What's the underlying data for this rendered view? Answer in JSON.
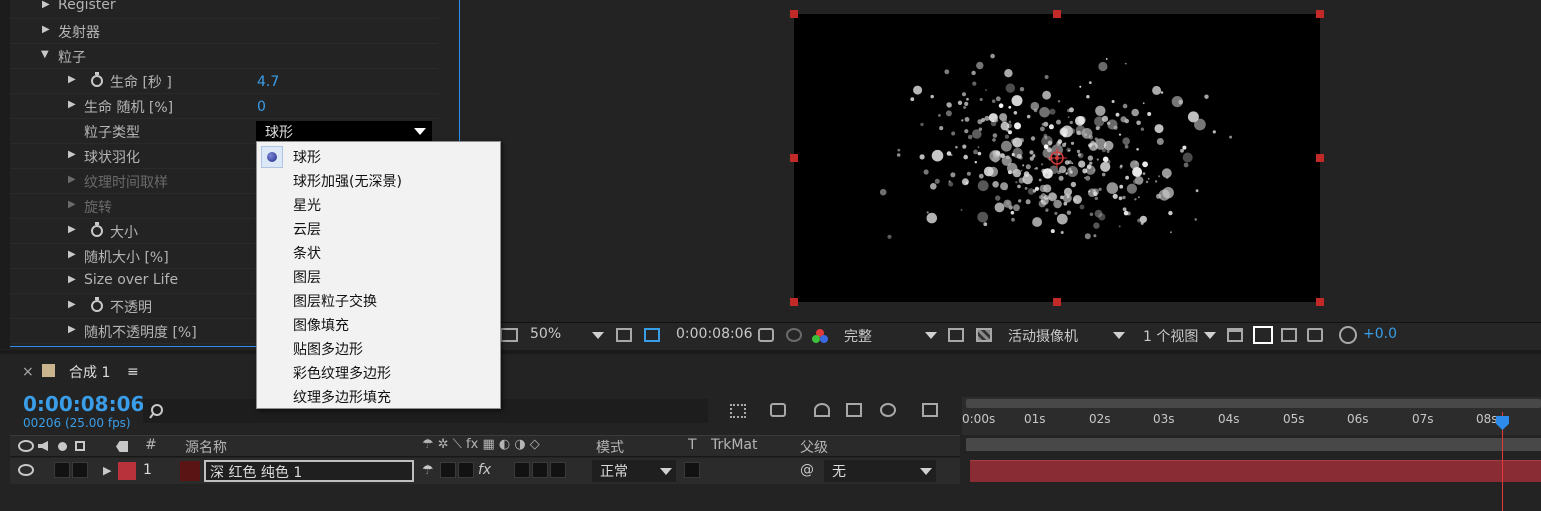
{
  "effects": {
    "rows": [
      {
        "label": "Register"
      },
      {
        "label": "发射器"
      },
      {
        "label": "粒子"
      },
      {
        "label": "生命 [秒 ]",
        "value": "4.7"
      },
      {
        "label": "生命 随机   [%]",
        "value": "0"
      },
      {
        "label": "粒子类型",
        "value": "球形"
      },
      {
        "label": "球状羽化"
      },
      {
        "label": "纹理时间取样"
      },
      {
        "label": "旋转"
      },
      {
        "label": "大小"
      },
      {
        "label": "随机大小   [%]"
      },
      {
        "label": "Size over Life"
      },
      {
        "label": "不透明"
      },
      {
        "label": "随机不透明度   [%]"
      }
    ]
  },
  "dropdown": {
    "selected": "球形",
    "options": [
      "球形",
      "球形加强(无深景)",
      "星光",
      "云层",
      "条状",
      "图层",
      "图层粒子交换",
      "图像填充",
      "贴图多边形",
      "彩色纹理多边形",
      "纹理多边形填充"
    ]
  },
  "viewer": {
    "zoom": "50%",
    "timecode": "0:00:08:06",
    "resolution": "完整",
    "camera": "活动摄像机",
    "views": "1 个视图",
    "exposure": "+0.0"
  },
  "timeline": {
    "tab_close": "×",
    "tab_label": "合成 1",
    "tab_menu": "≡",
    "timecode": "0:00:08:06",
    "frames": "00206 (25.00 fps)",
    "ruler_ticks": [
      "0:00s",
      "01s",
      "02s",
      "03s",
      "04s",
      "05s",
      "06s",
      "07s",
      "08s"
    ],
    "columns": {
      "num": "#",
      "source": "源名称",
      "mode": "模式",
      "t": "T",
      "trkmat": "TrkMat",
      "parent": "父级"
    },
    "layer": {
      "number": "1",
      "name": "深 红色 纯色 1",
      "mode": "正常",
      "parent": "无"
    }
  },
  "colors": {
    "accent": "#3a9de8",
    "layer_label": "#b8323b",
    "track": "#8a2c33",
    "playhead": "#e23a3a"
  }
}
